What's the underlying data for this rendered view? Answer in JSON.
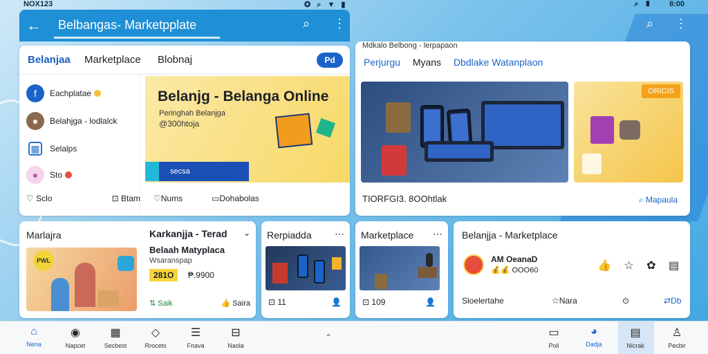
{
  "status": {
    "left": "NOX123",
    "right": "8:00",
    "icons_left": "✪ ⌕ ▼ ▮",
    "icons_right": "⌕ ▮"
  },
  "appbar": {
    "title": "Belbangas- Marketpplate"
  },
  "left_card": {
    "tabs": [
      "Belanjaa",
      "Marketplace",
      "Blobnaj"
    ],
    "pill": "Pd",
    "menu": [
      {
        "label": "Eachplatae",
        "icon": "facebook-icon",
        "color": "#1a64c9",
        "badge": "#f1c232"
      },
      {
        "label": "Belahjga - lodlalck",
        "icon": "avatar-icon",
        "color": "#8a6a4f",
        "badge": ""
      },
      {
        "label": "Selalps",
        "icon": "calendar-icon",
        "color": "#2a73c8",
        "badge": ""
      },
      {
        "label": "Sto",
        "icon": "bell-icon",
        "color": "#d783c7",
        "badge": "#e84c3d"
      }
    ],
    "footer": [
      "Sclo",
      "Btam"
    ],
    "promo": {
      "title": "Belanjg - Belanga Online",
      "sub": "Peringhah Belanjga",
      "sub2": "@300htoja",
      "button": "secsa"
    },
    "promo_footer": [
      "Nums",
      "Dohabolas"
    ]
  },
  "right_card": {
    "crumb": "Mdkalo Belbong - lerpapaon",
    "tabs": [
      "Perjurgu",
      "Myans",
      "Dbdlake Watanplaon"
    ],
    "tag": "ORICIS",
    "footer": "TIORFGI3. 8OOhtlak",
    "footer_right": "Mapaula"
  },
  "bottom_cards": {
    "c1": {
      "title": "Marlajra",
      "badge": "PWL",
      "right_title": "Karkanjja - Terad",
      "right_t2": "Belaah Matyplaca",
      "right_t3": "Wsaranspap",
      "price": "281O",
      "price2": "₱.9900",
      "foot_l": "Saik",
      "foot_r": "Saira"
    },
    "c2": {
      "title": "Rerpiadda",
      "foot_l": "11",
      "foot_r": ""
    },
    "c3": {
      "title": "Marketplace",
      "foot_l": "109",
      "foot_r": ""
    },
    "c4": {
      "title": "Belanjja - Marketplace",
      "t1": "AM OeanaD",
      "t2": "💰💰 OOO60",
      "foot": [
        "Sloelertahe",
        "Nara",
        "Db"
      ]
    }
  },
  "bottom_nav": [
    {
      "label": "Nena",
      "icon": "home-icon",
      "active": true
    },
    {
      "label": "Napcet",
      "icon": "camera-icon"
    },
    {
      "label": "Secbest",
      "icon": "calendar-icon"
    },
    {
      "label": "Rrocets",
      "icon": "tag-icon"
    },
    {
      "label": "Fnava",
      "icon": "list-icon"
    },
    {
      "label": "Naola",
      "icon": "bag-icon"
    },
    {
      "label": "Poil",
      "icon": "doc-icon"
    },
    {
      "label": "Dadja",
      "icon": "avatar-icon",
      "active": true
    },
    {
      "label": "Nicrak",
      "icon": "grid-icon"
    },
    {
      "label": "Pecbir",
      "icon": "user-icon"
    }
  ],
  "colors": {
    "accent": "#1a64c9",
    "appbar": "#1f8fd6"
  }
}
